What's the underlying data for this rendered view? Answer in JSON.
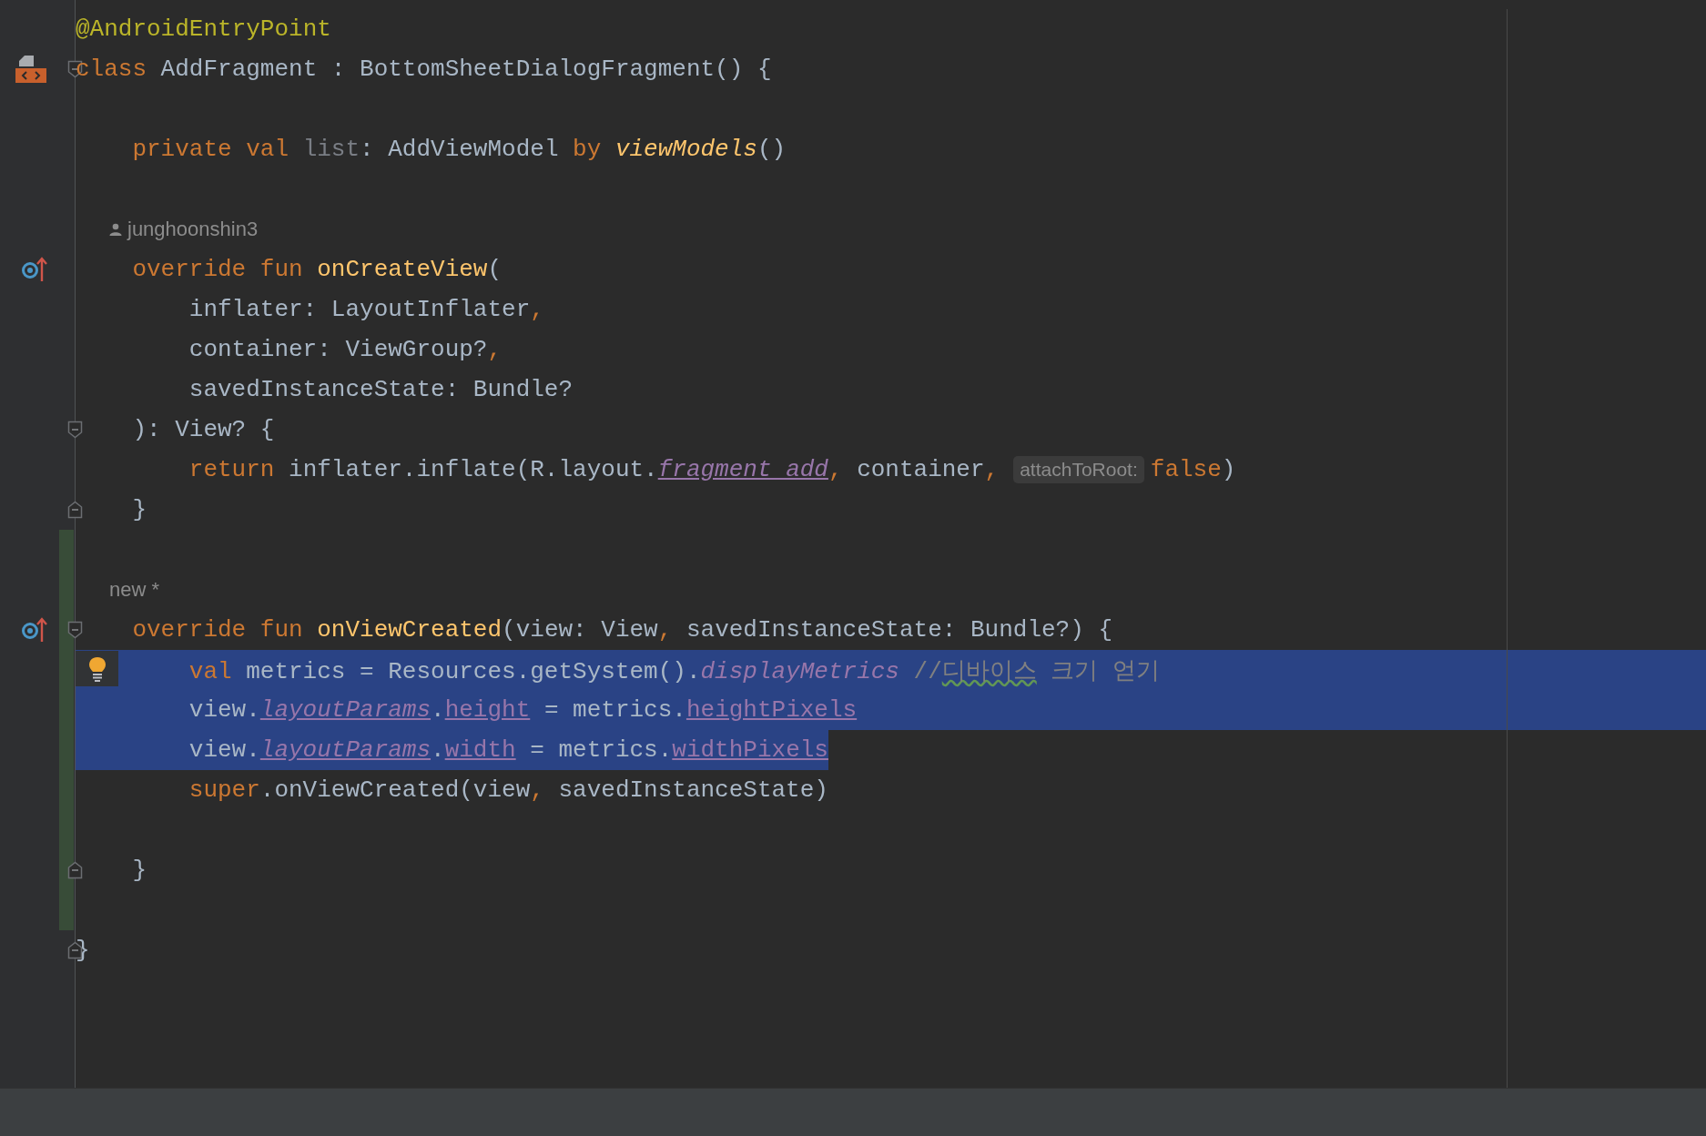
{
  "lines": [
    {
      "kind": "code",
      "selected": false,
      "changed": false,
      "tokens": [
        {
          "t": "@AndroidEntryPoint",
          "kind": "annotation"
        }
      ]
    },
    {
      "kind": "code",
      "selected": false,
      "changed": false,
      "marker": {
        "kind": "implemented"
      },
      "fold": {
        "kind": "start"
      },
      "tokens": [
        {
          "t": "class",
          "kind": "keyword"
        },
        {
          "t": " AddFragment : BottomSheetDialogFragment() {",
          "kind": "plain"
        }
      ]
    },
    {
      "kind": "code",
      "selected": false,
      "changed": false
    },
    {
      "kind": "code",
      "selected": false,
      "changed": false,
      "tokens": [
        {
          "t": "    private val ",
          "kind": "keyword"
        },
        {
          "t": "list",
          "kind": "unused"
        },
        {
          "t": ": AddViewModel ",
          "kind": "plain"
        },
        {
          "t": "by ",
          "kind": "keyword"
        },
        {
          "t": "viewModels",
          "kind": "call"
        },
        {
          "t": "()",
          "kind": "plain"
        }
      ]
    },
    {
      "kind": "code",
      "selected": false,
      "changed": false
    },
    {
      "kind": "author",
      "selected": false,
      "changed": false,
      "text": "junghoonshin3"
    },
    {
      "kind": "code",
      "selected": false,
      "changed": false,
      "marker": {
        "kind": "override"
      },
      "tokens": [
        {
          "t": "    override fun ",
          "kind": "keyword"
        },
        {
          "t": "onCreateView",
          "kind": "function"
        },
        {
          "t": "(",
          "kind": "plain"
        }
      ]
    },
    {
      "kind": "code",
      "selected": false,
      "changed": false,
      "tokens": [
        {
          "t": "        inflater: LayoutInflater",
          "kind": "plain"
        },
        {
          "t": ",",
          "kind": "comma"
        }
      ]
    },
    {
      "kind": "code",
      "selected": false,
      "changed": false,
      "tokens": [
        {
          "t": "        container: ViewGroup?",
          "kind": "plain"
        },
        {
          "t": ",",
          "kind": "comma"
        }
      ]
    },
    {
      "kind": "code",
      "selected": false,
      "changed": false,
      "tokens": [
        {
          "t": "        savedInstanceState: Bundle?",
          "kind": "plain"
        }
      ]
    },
    {
      "kind": "code",
      "selected": false,
      "changed": false,
      "fold": {
        "kind": "start"
      },
      "tokens": [
        {
          "t": "    ): View? {",
          "kind": "plain"
        }
      ]
    },
    {
      "kind": "code",
      "selected": false,
      "changed": false,
      "tokens": [
        {
          "t": "        return",
          "kind": "keyword"
        },
        {
          "t": " inflater.inflate(R.layout.",
          "kind": "plain"
        },
        {
          "t": "fragment_add",
          "kind": "synthetic"
        },
        {
          "t": ",",
          "kind": "comma"
        },
        {
          "t": " container",
          "kind": "plain"
        },
        {
          "t": ",",
          "kind": "comma"
        },
        {
          "t": "attachToRoot:",
          "kind": "inlay"
        },
        {
          "t": "false",
          "kind": "keyword"
        },
        {
          "t": ")",
          "kind": "plain"
        }
      ]
    },
    {
      "kind": "code",
      "selected": false,
      "changed": false,
      "fold": {
        "kind": "end"
      },
      "tokens": [
        {
          "t": "    }",
          "kind": "plain"
        }
      ]
    },
    {
      "kind": "code",
      "selected": false,
      "changed": true
    },
    {
      "kind": "hint",
      "selected": false,
      "changed": true,
      "text": "new *"
    },
    {
      "kind": "code",
      "selected": false,
      "changed": true,
      "marker": {
        "kind": "override"
      },
      "fold": {
        "kind": "start"
      },
      "tokens": [
        {
          "t": "    override fun ",
          "kind": "keyword"
        },
        {
          "t": "onViewCreated",
          "kind": "function"
        },
        {
          "t": "(view: View",
          "kind": "plain"
        },
        {
          "t": ",",
          "kind": "comma"
        },
        {
          "t": " savedInstanceState: Bundle?) {",
          "kind": "plain"
        }
      ]
    },
    {
      "kind": "code",
      "selected": true,
      "selection_extends": true,
      "intention": true,
      "changed": true,
      "tokens": [
        {
          "t": "        val",
          "kind": "keyword"
        },
        {
          "t": " metrics = Resources.getSystem().",
          "kind": "plain"
        },
        {
          "t": "displayMetrics",
          "kind": "property"
        },
        {
          "t": " //",
          "kind": "comment"
        },
        {
          "t": "디바이스",
          "kind": "typo"
        },
        {
          "t": " 크기 얻기",
          "kind": "comment"
        }
      ]
    },
    {
      "kind": "code",
      "selected": true,
      "selection_extends": true,
      "changed": true,
      "tokens": [
        {
          "t": "        view.",
          "kind": "plain"
        },
        {
          "t": "layoutParams",
          "kind": "synthetic"
        },
        {
          "t": ".",
          "kind": "plain"
        },
        {
          "t": "height",
          "kind": "field"
        },
        {
          "t": " = metrics.",
          "kind": "plain"
        },
        {
          "t": "heightPixels",
          "kind": "field"
        }
      ]
    },
    {
      "kind": "code",
      "selected": true,
      "selection_extends": false,
      "changed": true,
      "tokens": [
        {
          "t": "        view.",
          "kind": "plain"
        },
        {
          "t": "layoutParams",
          "kind": "synthetic"
        },
        {
          "t": ".",
          "kind": "plain"
        },
        {
          "t": "width",
          "kind": "field"
        },
        {
          "t": " = metrics.",
          "kind": "plain"
        },
        {
          "t": "widthPixels",
          "kind": "field"
        }
      ]
    },
    {
      "kind": "code",
      "selected": false,
      "changed": true,
      "tokens": [
        {
          "t": "        super",
          "kind": "keyword"
        },
        {
          "t": ".onViewCreated(view",
          "kind": "plain"
        },
        {
          "t": ",",
          "kind": "comma"
        },
        {
          "t": " savedInstanceState)",
          "kind": "plain"
        }
      ]
    },
    {
      "kind": "code",
      "selected": false,
      "changed": true
    },
    {
      "kind": "code",
      "selected": false,
      "changed": true,
      "fold": {
        "kind": "end"
      },
      "tokens": [
        {
          "t": "    }",
          "kind": "plain"
        }
      ]
    },
    {
      "kind": "code",
      "selected": false,
      "changed": true
    },
    {
      "kind": "code",
      "selected": false,
      "changed": false,
      "fold": {
        "kind": "end"
      },
      "tokens": [
        {
          "t": "}",
          "kind": "plain"
        }
      ]
    }
  ]
}
